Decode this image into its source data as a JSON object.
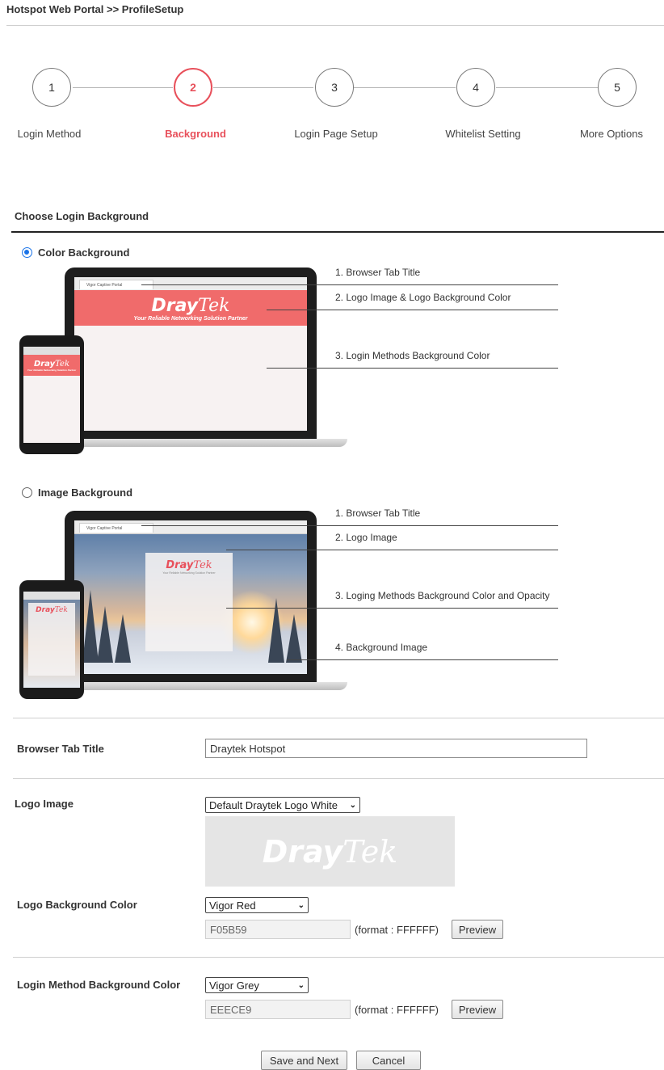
{
  "breadcrumb": "Hotspot Web Portal >> ProfileSetup",
  "steps": [
    {
      "number": "1",
      "label": "Login Method",
      "active": false
    },
    {
      "number": "2",
      "label": "Background",
      "active": true
    },
    {
      "number": "3",
      "label": "Login Page Setup",
      "active": false
    },
    {
      "number": "4",
      "label": "Whitelist Setting",
      "active": false
    },
    {
      "number": "5",
      "label": "More Options",
      "active": false
    }
  ],
  "section_title": "Choose Login Background",
  "color_option": {
    "label": "Color Background",
    "checked": true,
    "annotations": [
      "1. Browser Tab Title",
      "2. Logo Image & Logo Background Color",
      "3. Login Methods Background Color"
    ]
  },
  "image_option": {
    "label": "Image Background",
    "checked": false,
    "annotations": [
      "1. Browser Tab Title",
      "2. Logo Image",
      "3. Loging Methods Background Color and Opacity",
      "4. Background Image"
    ]
  },
  "mockup": {
    "tab_title": "Vigor Captive Portal",
    "logo_dray": "Dray",
    "logo_tek": "Tek",
    "tagline": "Your Reliable Networking Solution Partner"
  },
  "form": {
    "browser_tab_title": {
      "label": "Browser Tab Title",
      "value": "Draytek Hotspot"
    },
    "logo_image": {
      "label": "Logo Image",
      "selected": "Default Draytek Logo White"
    },
    "logo_bg_color": {
      "label": "Logo Background Color",
      "selected": "Vigor Red",
      "hex": "F05B59",
      "format": "(format : FFFFFF)",
      "preview": "Preview"
    },
    "login_bg_color": {
      "label": "Login Method Background Color",
      "selected": "Vigor Grey",
      "hex": "EEECE9",
      "format": "(format : FFFFFF)",
      "preview": "Preview"
    }
  },
  "buttons": {
    "save_next": "Save and Next",
    "cancel": "Cancel"
  },
  "colors": {
    "accent": "#e8505b",
    "logo_red": "#f06b6b",
    "radio_blue": "#1a73e8"
  }
}
